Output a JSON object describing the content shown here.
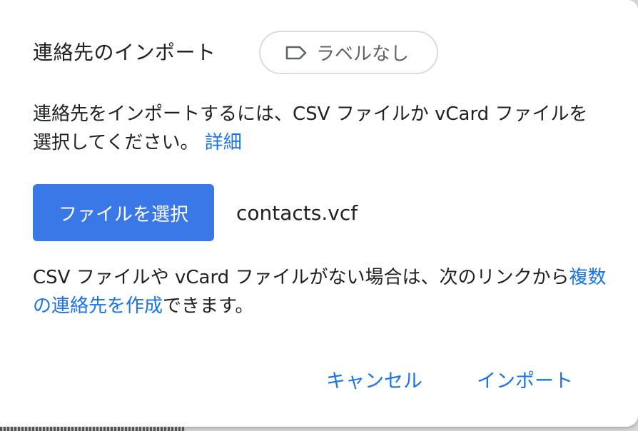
{
  "dialog": {
    "title": "連絡先のインポート",
    "label_chip": "ラベルなし",
    "description": "連絡先をインポートするには、CSV ファイルか vCard ファイルを選択してください。",
    "details_link": "詳細",
    "choose_file_button": "ファイルを選択",
    "file_name": "contacts.vcf",
    "note_prefix": "CSV ファイルや vCard ファイルがない場合は、次のリンクから",
    "note_link": "複数の連絡先を作成",
    "note_suffix": "できます。",
    "cancel_button": "キャンセル",
    "import_button": "インポート"
  },
  "icons": {
    "label": "label-outline-icon"
  },
  "colors": {
    "accent": "#1a73e8",
    "button": "#3b78e7",
    "text": "#202124",
    "muted": "#5f6368"
  }
}
